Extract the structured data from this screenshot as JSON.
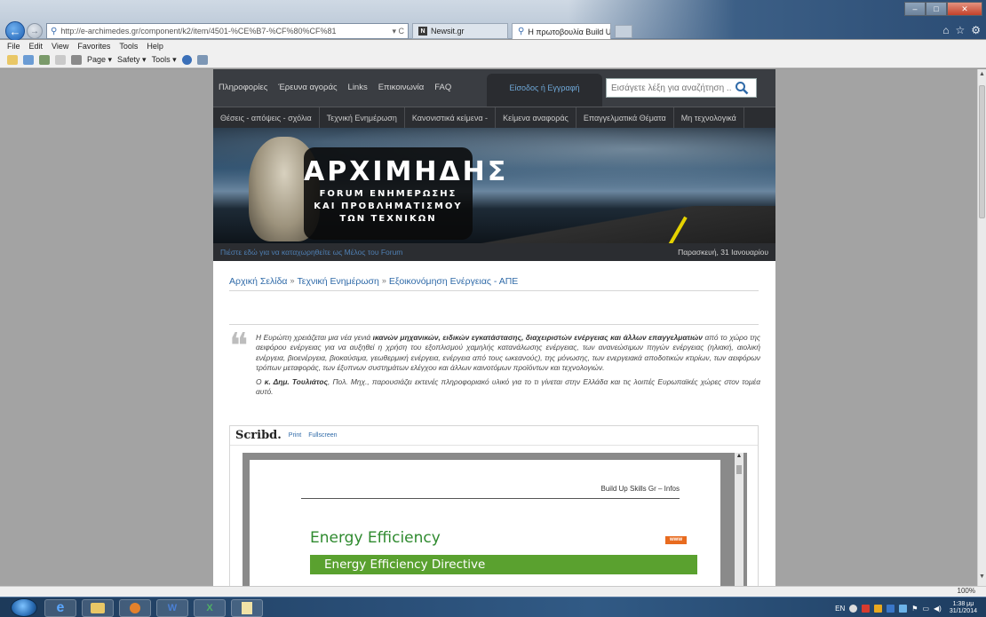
{
  "browser": {
    "address_url": "http://e-archimedes.gr/component/k2/item/4501-%CE%B7-%CF%80%CF%81",
    "address_domain": "e-archimedes.gr",
    "address_tools": "▾ C",
    "tabs": [
      {
        "label": "Newsit.gr",
        "favicon": "N"
      },
      {
        "label": "Η πρωτοβουλία Build Up S...",
        "favicon": "search-icon"
      }
    ],
    "menu": [
      "File",
      "Edit",
      "View",
      "Favorites",
      "Tools",
      "Help"
    ],
    "commands": [
      "Page ▾",
      "Safety ▾",
      "Tools ▾"
    ],
    "zoom": "100%"
  },
  "site": {
    "top_links": [
      "Πληροφορίες",
      "Έρευνα αγοράς",
      "Links",
      "Επικοινωνία",
      "FAQ"
    ],
    "login_label": "Είσοδος ή Εγγραφή",
    "search_placeholder": "Εισάγετε λέξη για αναζήτηση ...",
    "main_nav": [
      "Θέσεις - απόψεις - σχόλια",
      "Τεχνική Ενημέρωση",
      "Κανονιστικά κείμενα -",
      "Κείμενα αναφοράς",
      "Επαγγελματικά Θέματα",
      "Μη τεχνολογικά"
    ],
    "logo_title": "ΑΡΧΙΜΗΔΗΣ",
    "logo_sub": [
      "FORUM ΕΝΗΜΕΡΩΣΗΣ",
      "ΚΑΙ ΠΡΟΒΛΗΜΑΤΙΣΜΟΥ",
      "ΤΩΝ ΤΕΧΝΙΚΩΝ"
    ],
    "register_text": "Πιέστε εδώ για να καταχωρηθείτε ως Μέλος του Forum",
    "date_text": "Παρασκευή, 31 Ιανουαρίου",
    "breadcrumb": [
      "Αρχική Σελίδα",
      "Τεχνική Ενημέρωση",
      "Εξοικονόμηση Ενέργειας - ΑΠΕ"
    ],
    "breadcrumb_sep": "»",
    "quote_p1_start": "Η Ευρώπη χρειάζεται μια νέα γενιά ",
    "quote_p1_bold": "ικανών μηχανικών, ειδικών εγκατάστασης, διαχειριστών ενέργειας και άλλων επαγγελματιών",
    "quote_p1_rest": " από το χώρο της αειφόρου ενέργειας για να αυξηθεί η χρήση του εξοπλισμού χαμηλής κατανάλωσης ενέργειας, των ανανεώσιμων πηγών ενέργειας (ηλιακή, αιολική ενέργεια, βιοενέργεια, βιοκαύσιμα, γεωθερμική ενέργεια, ενέργεια από τους ωκεανούς), της μόνωσης, των ενεργειακά αποδοτικών κτιρίων, των αειφόρων τρόπων μεταφοράς, των έξυπνων συστημάτων ελέγχου και άλλων καινοτόμων προϊόντων και τεχνολογιών.",
    "quote_p2_start": "Ο ",
    "quote_p2_bold": "κ. Δημ. Τουλιάτος",
    "quote_p2_rest": ", Πολ. Μηχ., παρουσιάζει εκτενές πληροφοριακό υλικό για το τι γίνεται στην Ελλάδα και τις λοιπές Ευρωπαϊκές χώρες στον τομέα αυτό.",
    "scribd": {
      "logo": "Scribd.",
      "links": [
        "Print",
        "Fullscreen"
      ],
      "doc_header": "Build Up Skills Gr – Infos",
      "doc_title": "Energy Efficiency",
      "doc_badge": "www",
      "doc_band": "Energy Efficiency Directive"
    }
  },
  "taskbar": {
    "apps": [
      "",
      "W",
      "X",
      ""
    ],
    "lang": "EN",
    "time": "1:38 μμ",
    "date": "31/1/2014"
  },
  "colors": {
    "link": "#2f6aa8",
    "nav_bg": "#2b2d31",
    "doc_green": "#5aa12f"
  }
}
